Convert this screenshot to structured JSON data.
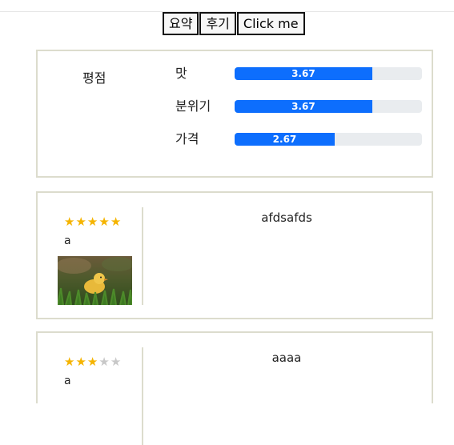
{
  "tabs": [
    "요약",
    "후기",
    "Click me"
  ],
  "summary": {
    "title": "평점",
    "ratings": [
      {
        "label": "맛",
        "value": "3.67",
        "percent": 0.734
      },
      {
        "label": "분위기",
        "value": "3.67",
        "percent": 0.734
      },
      {
        "label": "가격",
        "value": "2.67",
        "percent": 0.534
      }
    ]
  },
  "reviews": [
    {
      "stars": 5,
      "max_stars": 5,
      "author": "a",
      "text": "afdsafds",
      "has_photo": true
    },
    {
      "stars": 3,
      "max_stars": 5,
      "author": "a",
      "text": "aaaa",
      "has_photo": false
    }
  ],
  "colors": {
    "accent": "#0d6efd",
    "star": "#f5b400",
    "border": "#dcdccd"
  }
}
